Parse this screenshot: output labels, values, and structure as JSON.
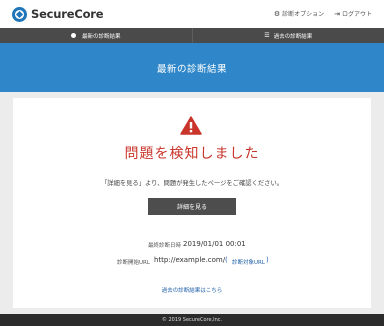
{
  "header": {
    "logo_text": "SecureCore",
    "links": [
      {
        "icon": "gear-icon",
        "label": "診断オプション"
      },
      {
        "icon": "logout-icon",
        "label": "ログアウト"
      }
    ]
  },
  "tabs": [
    {
      "label": "最新の診断結果",
      "icon": "dot-icon"
    },
    {
      "label": "過去の診断結果",
      "icon": "list-icon"
    }
  ],
  "banner": {
    "title": "最新の診断結果"
  },
  "result": {
    "alert_icon": "warning-icon",
    "title": "問題を検知しました",
    "description": "「詳細を見る」より、問題が発生したページをご確認ください。",
    "detail_button": "詳細を見る",
    "latest_label": "最終診断日時",
    "latest_value": "2019/01/01 00:01",
    "url_label": "診断開始URL",
    "url_value": "http://example.com/",
    "target_link": "診断対象URL",
    "past_link": "過去の診断結果はこちら"
  },
  "footer": {
    "copyright": "© 2019 SecureCore,Inc."
  },
  "colors": {
    "accent": "#2f87c9",
    "alert": "#c9352b",
    "tabbar": "#4a4a4a"
  }
}
